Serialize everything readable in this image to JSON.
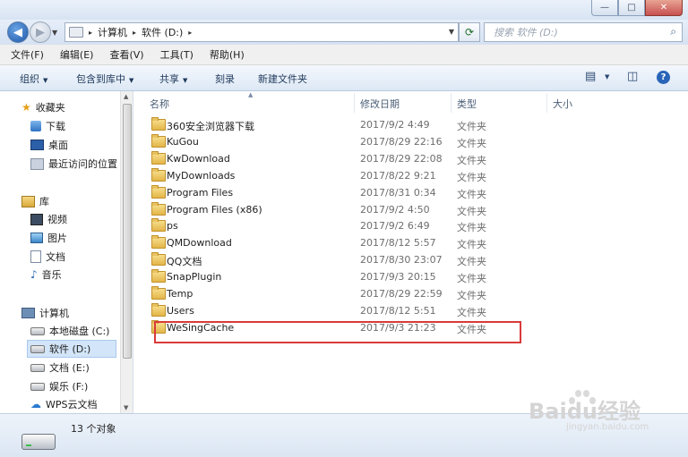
{
  "window": {
    "controls": {
      "minimize": "—",
      "maximize": "□",
      "close": "✕"
    }
  },
  "address": {
    "crumbs": [
      "计算机",
      "软件 (D:)"
    ],
    "separator": "▸",
    "search_placeholder": "搜索 软件 (D:)"
  },
  "menu": [
    "文件(F)",
    "编辑(E)",
    "查看(V)",
    "工具(T)",
    "帮助(H)"
  ],
  "toolbar": {
    "organize": "组织",
    "include_library": "包含到库中",
    "share": "共享",
    "burn": "刻录",
    "new_folder": "新建文件夹",
    "help": "?"
  },
  "nav": {
    "favorites": "收藏夹",
    "downloads": "下载",
    "desktop": "桌面",
    "recent": "最近访问的位置",
    "libraries": "库",
    "videos": "视频",
    "pictures": "图片",
    "documents": "文档",
    "music": "音乐",
    "computer": "计算机",
    "drive_c": "本地磁盘 (C:)",
    "drive_d": "软件 (D:)",
    "drive_e": "文档 (E:)",
    "drive_f": "娱乐 (F:)",
    "wps": "WPS云文档"
  },
  "columns": {
    "name": "名称",
    "date": "修改日期",
    "type": "类型",
    "size": "大小"
  },
  "files": [
    {
      "name": "360安全浏览器下载",
      "date": "2017/9/2 4:49",
      "type": "文件夹"
    },
    {
      "name": "KuGou",
      "date": "2017/8/29 22:16",
      "type": "文件夹"
    },
    {
      "name": "KwDownload",
      "date": "2017/8/29 22:08",
      "type": "文件夹"
    },
    {
      "name": "MyDownloads",
      "date": "2017/8/22 9:21",
      "type": "文件夹"
    },
    {
      "name": "Program Files",
      "date": "2017/8/31 0:34",
      "type": "文件夹"
    },
    {
      "name": "Program Files (x86)",
      "date": "2017/9/2 4:50",
      "type": "文件夹"
    },
    {
      "name": "ps",
      "date": "2017/9/2 6:49",
      "type": "文件夹"
    },
    {
      "name": "QMDownload",
      "date": "2017/8/12 5:57",
      "type": "文件夹"
    },
    {
      "name": "QQ文档",
      "date": "2017/8/30 23:07",
      "type": "文件夹"
    },
    {
      "name": "SnapPlugin",
      "date": "2017/9/3 20:15",
      "type": "文件夹"
    },
    {
      "name": "Temp",
      "date": "2017/8/29 22:59",
      "type": "文件夹"
    },
    {
      "name": "Users",
      "date": "2017/8/12 5:51",
      "type": "文件夹"
    },
    {
      "name": "WeSingCache",
      "date": "2017/9/3 21:23",
      "type": "文件夹"
    }
  ],
  "status": {
    "count": "13 个对象"
  },
  "watermark": {
    "main": "Baidu经验",
    "sub": "jingyan.baidu.com"
  }
}
